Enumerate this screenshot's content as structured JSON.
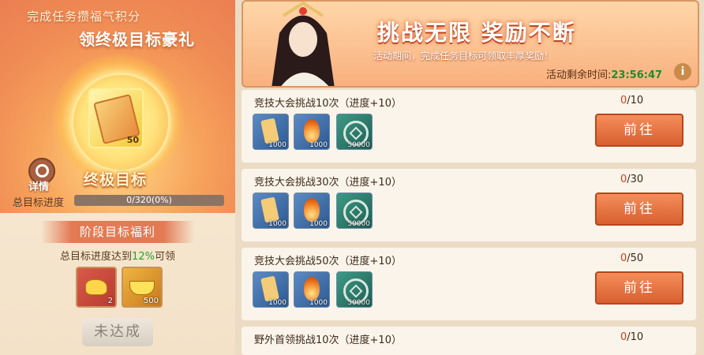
{
  "left": {
    "promo_line1": "完成任务攒福气积分",
    "promo_line2": "领终极目标豪礼",
    "grand_item_count": "50",
    "details_label": "详情",
    "ultimate_goal_label": "终极目标",
    "total_progress_label": "总目标进度",
    "total_progress_text": "0/320(0%)",
    "total_progress_fraction": 0,
    "stage_title": "阶段目标福利",
    "stage_req_prefix": "总目标进度达到",
    "stage_req_pct": "12%",
    "stage_req_suffix": "可领",
    "stage_rewards": [
      {
        "icon": "gold-nugget-icon",
        "count": "2"
      },
      {
        "icon": "gold-ingot-icon",
        "count": "500"
      }
    ],
    "claim_button": "未达成"
  },
  "banner": {
    "title": "挑战无限 奖励不断",
    "subtitle": "活动期间，完成任务目标可领取丰厚奖励！",
    "timer_label": "活动剩余时间:",
    "timer_value": "23:56:47",
    "info": "i"
  },
  "tasks": [
    {
      "title": "竞技大会挑战10次（进度+10）",
      "count_done": "0",
      "count_total": "/10",
      "go": "前往",
      "rewards": [
        {
          "icon": "scroll-icon",
          "q": "1000"
        },
        {
          "icon": "flame-icon",
          "q": "1000"
        },
        {
          "icon": "coin-icon",
          "q": "50000"
        }
      ]
    },
    {
      "title": "竞技大会挑战30次（进度+10）",
      "count_done": "0",
      "count_total": "/30",
      "go": "前往",
      "rewards": [
        {
          "icon": "scroll-icon",
          "q": "1000"
        },
        {
          "icon": "flame-icon",
          "q": "1000"
        },
        {
          "icon": "coin-icon",
          "q": "50000"
        }
      ]
    },
    {
      "title": "竞技大会挑战50次（进度+10）",
      "count_done": "0",
      "count_total": "/50",
      "go": "前往",
      "rewards": [
        {
          "icon": "scroll-icon",
          "q": "1000"
        },
        {
          "icon": "flame-icon",
          "q": "1000"
        },
        {
          "icon": "coin-icon",
          "q": "50000"
        }
      ]
    },
    {
      "title": "野外首领挑战10次（进度+10）",
      "count_done": "0",
      "count_total": "/10"
    }
  ],
  "colors": {
    "accent": "#d85f30",
    "timer": "#1f8d2c",
    "count": "#d0401a"
  }
}
